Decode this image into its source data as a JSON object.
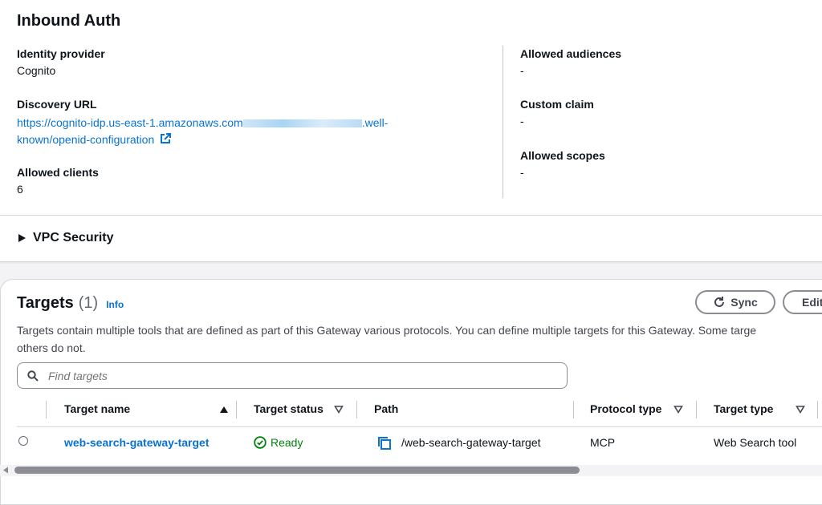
{
  "inbound_auth": {
    "title": "Inbound Auth",
    "identity_provider": {
      "label": "Identity provider",
      "value": "Cognito"
    },
    "discovery_url": {
      "label": "Discovery URL",
      "value_part1": "https://cognito-idp.us-east-1.amazonaws.com",
      "value_part2": ".well-",
      "value_part3": "known/openid-configuration"
    },
    "allowed_clients": {
      "label": "Allowed clients",
      "value": "6"
    },
    "allowed_audiences": {
      "label": "Allowed audiences",
      "value": "-"
    },
    "custom_claim": {
      "label": "Custom claim",
      "value": "-"
    },
    "allowed_scopes": {
      "label": "Allowed scopes",
      "value": "-"
    }
  },
  "vpc_security": {
    "label": "VPC Security"
  },
  "targets": {
    "title": "Targets",
    "count": "(1)",
    "info": "Info",
    "sync_label": "Sync",
    "edit_label": "Edit",
    "description_line1": "Targets contain multiple tools that are defined as part of this Gateway various protocols. You can define multiple targets for this Gateway. Some targe",
    "description_line2": "others do not.",
    "search_placeholder": "Find targets",
    "columns": [
      "Target name",
      "Target status",
      "Path",
      "Protocol type",
      "Target type"
    ],
    "rows": [
      {
        "name": "web-search-gateway-target",
        "status": "Ready",
        "path": "/web-search-gateway-target",
        "protocol": "MCP",
        "type": "Web Search tool"
      }
    ]
  },
  "colors": {
    "link": "#0972d3",
    "success": "#037f0c",
    "border": "#8c8c94"
  }
}
